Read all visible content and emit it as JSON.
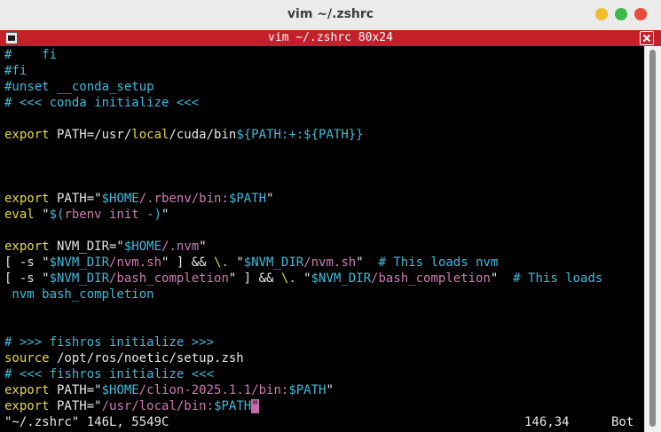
{
  "window": {
    "title": "vim ~/.zshrc"
  },
  "tab": {
    "title": "vim ~/.zshrc 80x24"
  },
  "lines": [
    [
      {
        "t": "#    fi",
        "c": "c"
      }
    ],
    [
      {
        "t": "#fi",
        "c": "c"
      }
    ],
    [
      {
        "t": "#unset __conda_setup",
        "c": "c"
      }
    ],
    [
      {
        "t": "# <<< conda initialize <<<",
        "c": "c"
      }
    ],
    [],
    [
      {
        "t": "export",
        "c": "k"
      },
      {
        "t": " PATH=/usr/",
        "c": "p"
      },
      {
        "t": "local",
        "c": "k"
      },
      {
        "t": "/cuda/bin",
        "c": "p"
      },
      {
        "t": "${PATH:+:${PATH}}",
        "c": "v"
      }
    ],
    [],
    [],
    [],
    [
      {
        "t": "export",
        "c": "k"
      },
      {
        "t": " PATH=\"",
        "c": "p"
      },
      {
        "t": "$HOME",
        "c": "v"
      },
      {
        "t": "/.rbenv/bin:",
        "c": "s"
      },
      {
        "t": "$PATH",
        "c": "v"
      },
      {
        "t": "\"",
        "c": "p"
      }
    ],
    [
      {
        "t": "eval",
        "c": "k"
      },
      {
        "t": " \"",
        "c": "p"
      },
      {
        "t": "$(",
        "c": "v"
      },
      {
        "t": "rbenv init -",
        "c": "s"
      },
      {
        "t": ")",
        "c": "v"
      },
      {
        "t": "\"",
        "c": "p"
      }
    ],
    [],
    [
      {
        "t": "export",
        "c": "k"
      },
      {
        "t": " NVM_DIR=\"",
        "c": "p"
      },
      {
        "t": "$HOME",
        "c": "v"
      },
      {
        "t": "/.nvm",
        "c": "s"
      },
      {
        "t": "\"",
        "c": "p"
      }
    ],
    [
      {
        "t": "[ -s \"",
        "c": "p"
      },
      {
        "t": "$NVM_DIR",
        "c": "v"
      },
      {
        "t": "/nvm.sh",
        "c": "s"
      },
      {
        "t": "\" ] && ",
        "c": "p"
      },
      {
        "t": "\\.",
        "c": "k"
      },
      {
        "t": " \"",
        "c": "p"
      },
      {
        "t": "$NVM_DIR",
        "c": "v"
      },
      {
        "t": "/nvm.sh",
        "c": "s"
      },
      {
        "t": "\"  ",
        "c": "p"
      },
      {
        "t": "# This loads nvm",
        "c": "c"
      }
    ],
    [
      {
        "t": "[ -s \"",
        "c": "p"
      },
      {
        "t": "$NVM_DIR",
        "c": "v"
      },
      {
        "t": "/bash_completion",
        "c": "s"
      },
      {
        "t": "\" ] && ",
        "c": "p"
      },
      {
        "t": "\\.",
        "c": "k"
      },
      {
        "t": " \"",
        "c": "p"
      },
      {
        "t": "$NVM_DIR",
        "c": "v"
      },
      {
        "t": "/bash_completion",
        "c": "s"
      },
      {
        "t": "\"  ",
        "c": "p"
      },
      {
        "t": "# This loads",
        "c": "c"
      }
    ],
    [
      {
        "t": " nvm bash_completion",
        "c": "c"
      }
    ],
    [],
    [],
    [
      {
        "t": "# >>> fishros initialize >>>",
        "c": "c"
      }
    ],
    [
      {
        "t": "source",
        "c": "k"
      },
      {
        "t": " /opt/ros/noetic/setup.zsh",
        "c": "p"
      }
    ],
    [
      {
        "t": "# <<< fishros initialize <<<",
        "c": "c"
      }
    ],
    [
      {
        "t": "export",
        "c": "k"
      },
      {
        "t": " PATH=\"",
        "c": "p"
      },
      {
        "t": "$HOME",
        "c": "v"
      },
      {
        "t": "/clion-2025.1.1/bin:",
        "c": "s"
      },
      {
        "t": "$PATH",
        "c": "v"
      },
      {
        "t": "\"",
        "c": "p"
      }
    ],
    [
      {
        "t": "export",
        "c": "k"
      },
      {
        "t": " PATH=\"",
        "c": "p"
      },
      {
        "t": "/usr/local/bin:",
        "c": "s"
      },
      {
        "t": "$PATH",
        "c": "v"
      },
      {
        "t": "\"",
        "c": "cursor"
      }
    ]
  ],
  "status": {
    "file": "\"~/.zshrc\" 146L, 5549C",
    "position": "146,34",
    "scroll": "Bot"
  },
  "colors": {
    "comment": "#3dbcdc",
    "keyword": "#e7d843",
    "string": "#d07ab2",
    "variable": "#3dbcdc",
    "tab_bar": "#c3202a"
  }
}
